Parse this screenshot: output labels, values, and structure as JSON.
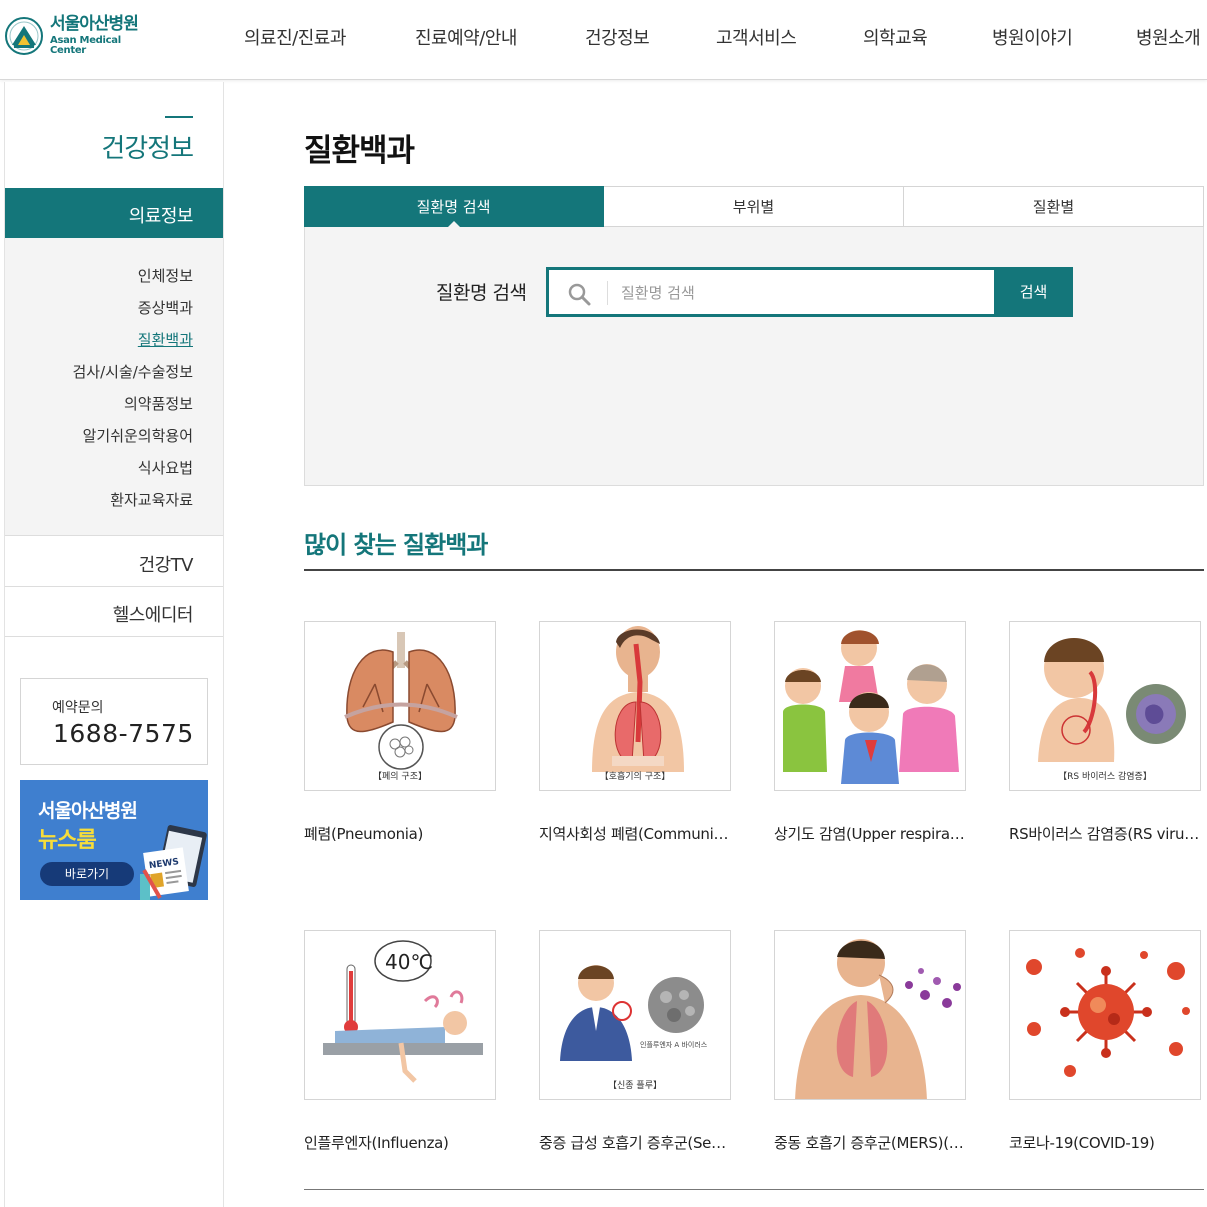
{
  "header": {
    "logo_kr": "서울아산병원",
    "logo_en": "Asan Medical Center",
    "nav": [
      "의료진/진료과",
      "진료예약/안내",
      "건강정보",
      "고객서비스",
      "의학교육",
      "병원이야기",
      "병원소개"
    ]
  },
  "sidebar": {
    "title": "건강정보",
    "active_section": "의료정보",
    "sub_items": [
      {
        "label": "인체정보",
        "active": false
      },
      {
        "label": "증상백과",
        "active": false
      },
      {
        "label": "질환백과",
        "active": true
      },
      {
        "label": "검사/시술/수술정보",
        "active": false
      },
      {
        "label": "의약품정보",
        "active": false
      },
      {
        "label": "알기쉬운의학용어",
        "active": false
      },
      {
        "label": "식사요법",
        "active": false
      },
      {
        "label": "환자교육자료",
        "active": false
      }
    ],
    "sections": [
      "건강TV",
      "헬스에디터"
    ],
    "call": {
      "label": "예약문의",
      "number": "1688-7575"
    },
    "banner": {
      "line1": "서울아산병원",
      "line2": "뉴스룸",
      "button": "바로가기",
      "art_text": "NEWS"
    }
  },
  "main": {
    "title": "질환백과",
    "tabs": [
      {
        "label": "질환명 검색",
        "active": true
      },
      {
        "label": "부위별",
        "active": false
      },
      {
        "label": "질환별",
        "active": false
      }
    ],
    "search": {
      "label": "질환명 검색",
      "placeholder": "질환명 검색",
      "value": "",
      "button": "검색"
    },
    "popular_title": "많이 찾는 질환백과",
    "cards": [
      {
        "title": "폐렴(Pneumonia)",
        "caption": "【폐의 구조】",
        "icon": "lungs-icon"
      },
      {
        "title": "지역사회성 폐렴(Community-acquired pneumonia)",
        "caption": "【호흡기의 구조】",
        "icon": "respiratory-tract-icon"
      },
      {
        "title": "상기도 감염(Upper respiratory infection)",
        "caption": "",
        "icon": "coughing-people-icon"
      },
      {
        "title": "RS바이러스 감염증(RS virus infection)",
        "caption": "【RS 바이러스 감염증】",
        "icon": "rs-virus-icon"
      },
      {
        "title": "인플루엔자(Influenza)",
        "caption": "",
        "icon": "fever-patient-icon",
        "art_text": "40℃"
      },
      {
        "title": "중증 급성 호흡기 증후군(Severe acute respiratory syndrome)",
        "caption": "【신종 플루】",
        "icon": "sars-icon",
        "art_text": "인플루엔자 A 바이러스"
      },
      {
        "title": "중동 호흡기 증후군(MERS)(Middle East respiratory syndrome)",
        "caption": "",
        "icon": "mers-icon"
      },
      {
        "title": "코로나-19(COVID-19)",
        "caption": "",
        "icon": "coronavirus-icon"
      }
    ]
  },
  "colors": {
    "brand": "#14767a",
    "panel": "#f4f4f4",
    "banner": "#3f7fcf",
    "banner_accent": "#f7dd3a"
  }
}
